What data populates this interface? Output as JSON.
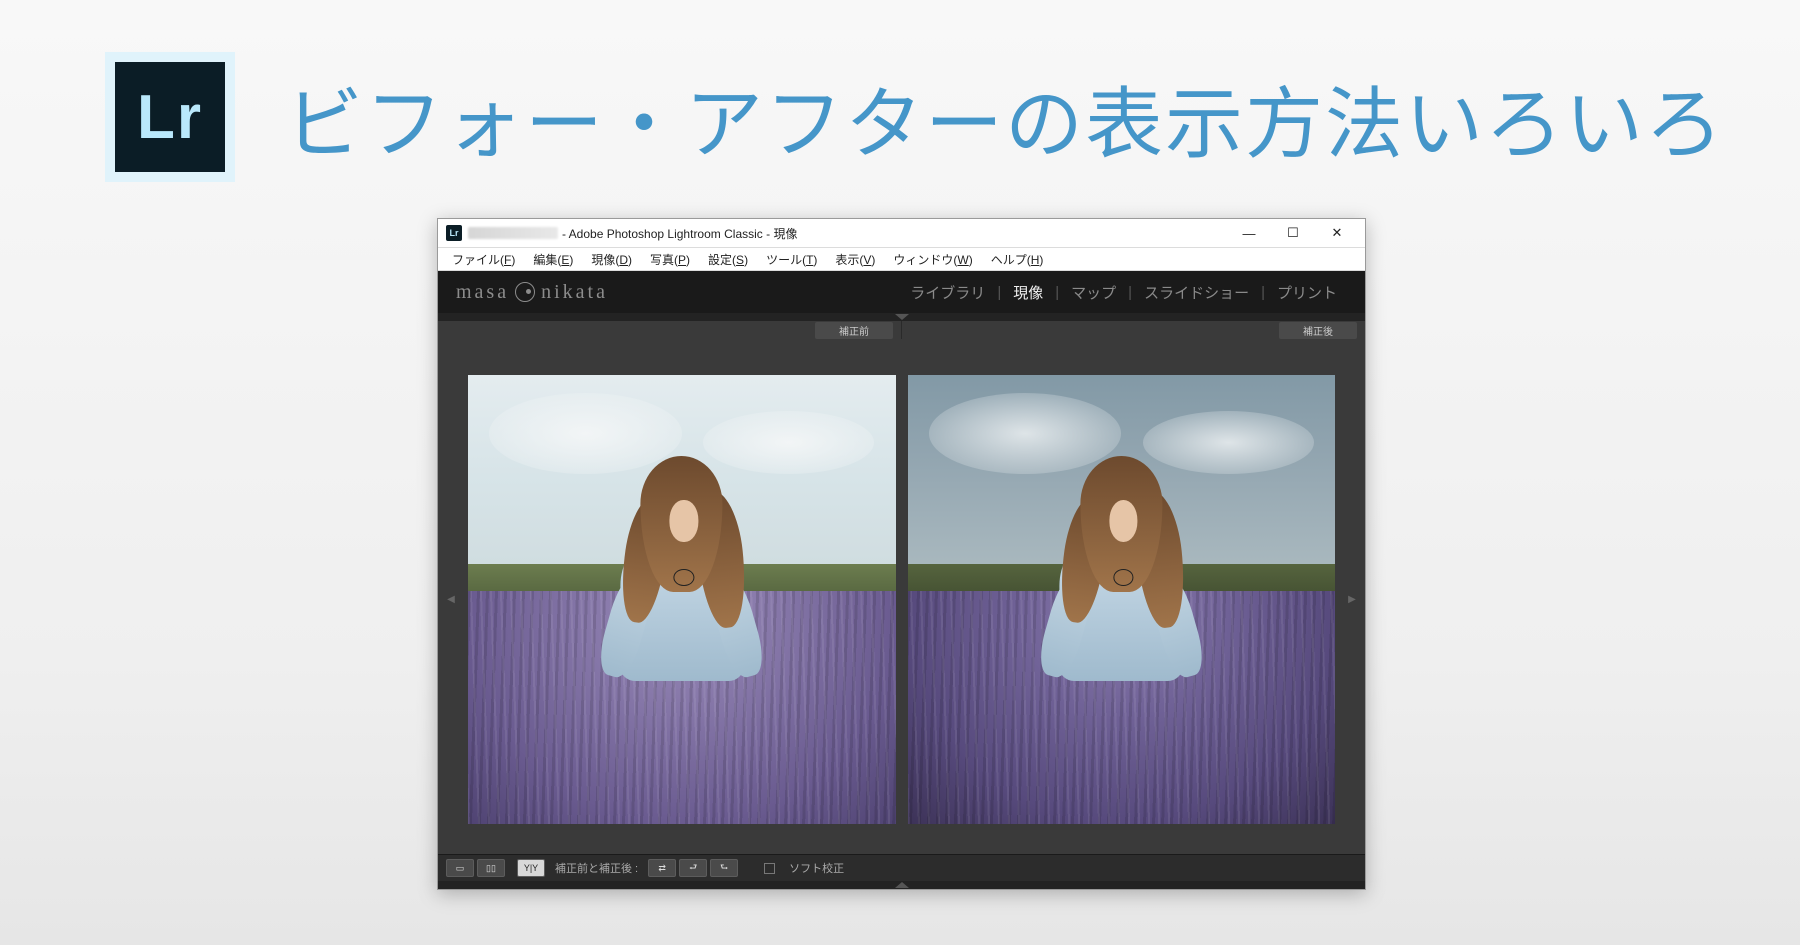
{
  "logo_text": "Lr",
  "headline": "ビフォー・アフターの表示方法いろいろ",
  "window": {
    "title_suffix": " - Adobe Photoshop Lightroom Classic - 現像",
    "menus": [
      {
        "plain": "ファイル(",
        "u": "F",
        "tail": ")"
      },
      {
        "plain": "編集(",
        "u": "E",
        "tail": ")"
      },
      {
        "plain": "現像(",
        "u": "D",
        "tail": ")"
      },
      {
        "plain": "写真(",
        "u": "P",
        "tail": ")"
      },
      {
        "plain": "設定(",
        "u": "S",
        "tail": ")"
      },
      {
        "plain": "ツール(",
        "u": "T",
        "tail": ")"
      },
      {
        "plain": "表示(",
        "u": "V",
        "tail": ")"
      },
      {
        "plain": "ウィンドウ(",
        "u": "W",
        "tail": ")"
      },
      {
        "plain": "ヘルプ(",
        "u": "H",
        "tail": ")"
      }
    ],
    "brand_left": "masa",
    "brand_right": "nikata",
    "modules": [
      "ライブラリ",
      "現像",
      "マップ",
      "スライドショー",
      "プリント"
    ],
    "active_module": "現像",
    "before_label": "補正前",
    "after_label": "補正後",
    "bottom": {
      "mode_label": "補正前と補正後 :",
      "soft_proof": "ソフト校正"
    }
  }
}
